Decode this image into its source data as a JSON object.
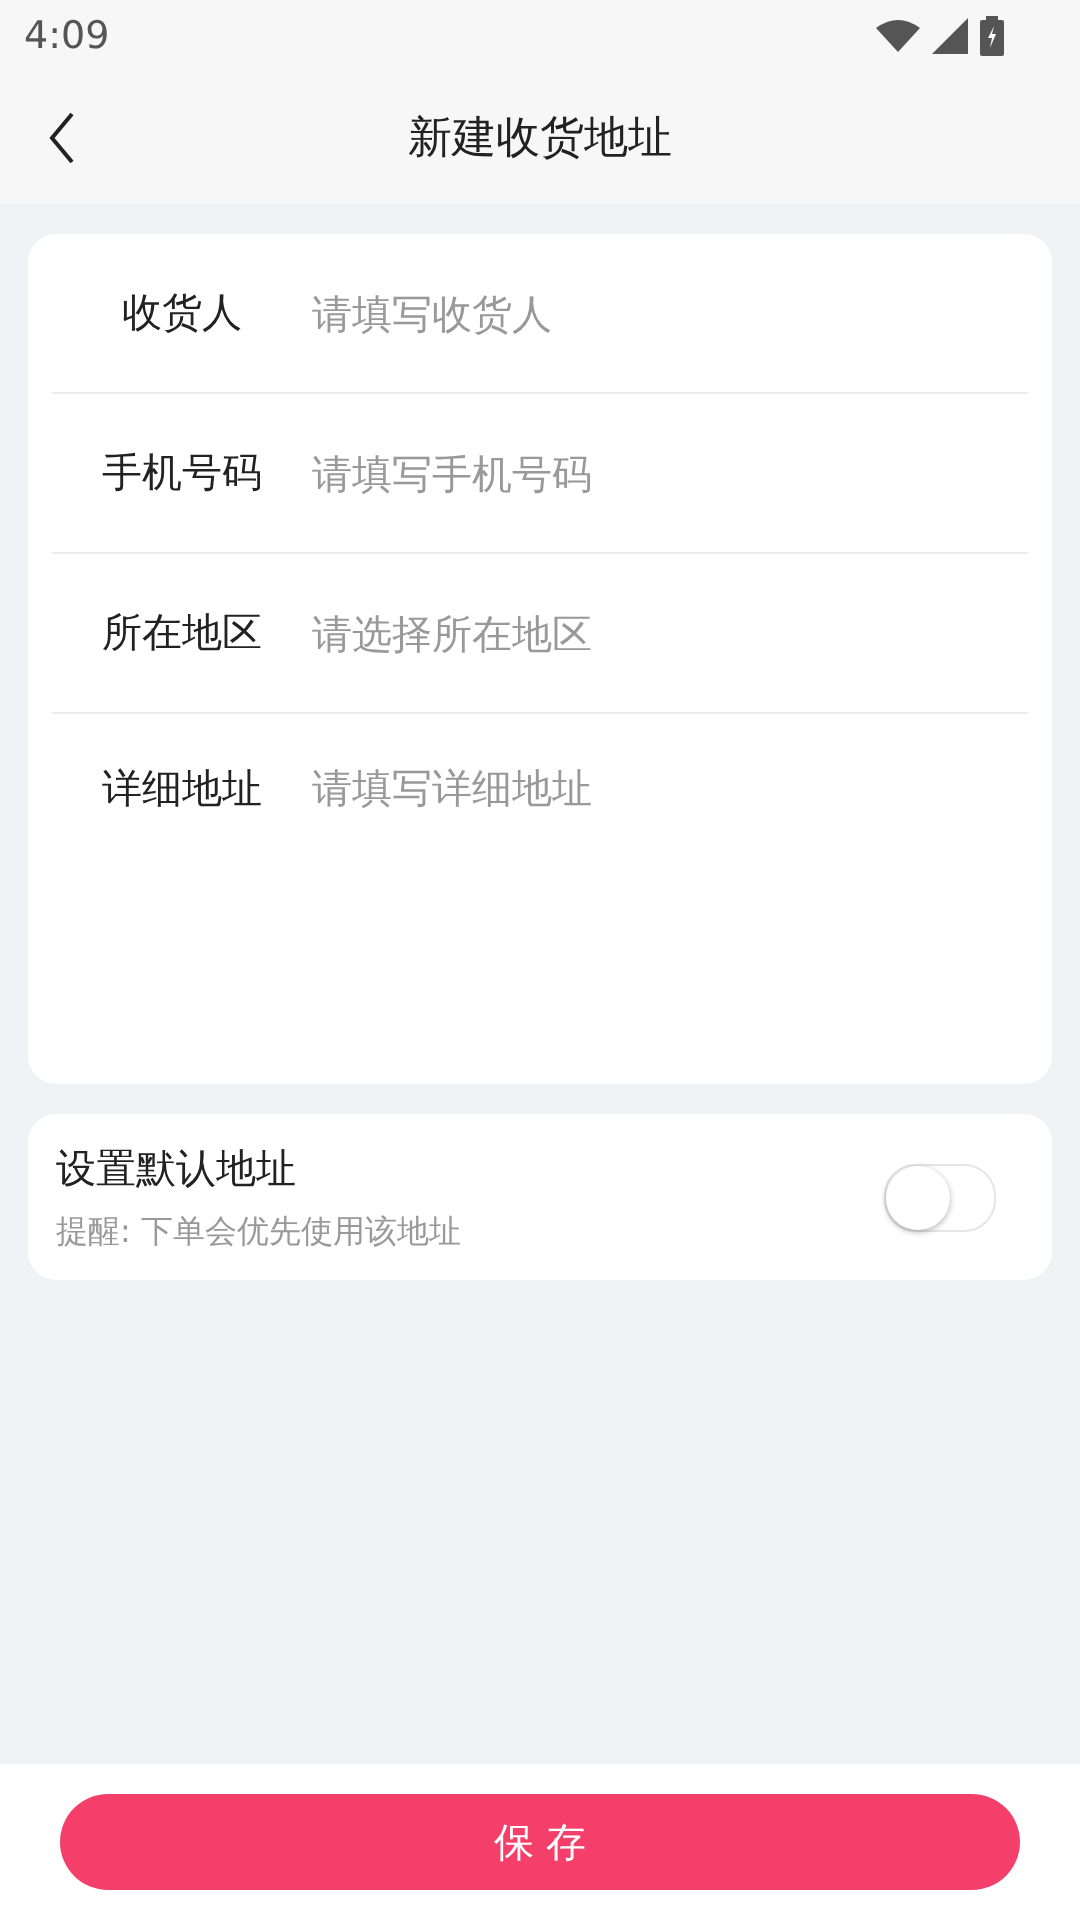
{
  "status_bar": {
    "time": "4:09"
  },
  "header": {
    "title": "新建收货地址"
  },
  "fields": [
    {
      "label": "收货人",
      "placeholder": "请填写收货人",
      "kind": "input"
    },
    {
      "label": "手机号码",
      "placeholder": "请填写手机号码",
      "kind": "input"
    },
    {
      "label": "所在地区",
      "placeholder": "请选择所在地区",
      "kind": "select"
    },
    {
      "label": "详细地址",
      "placeholder": "请填写详细地址",
      "kind": "textarea"
    }
  ],
  "default_address": {
    "title": "设置默认地址",
    "hint": "提醒: 下单会优先使用该地址",
    "on": false
  },
  "save_button": {
    "label": "保 存"
  }
}
